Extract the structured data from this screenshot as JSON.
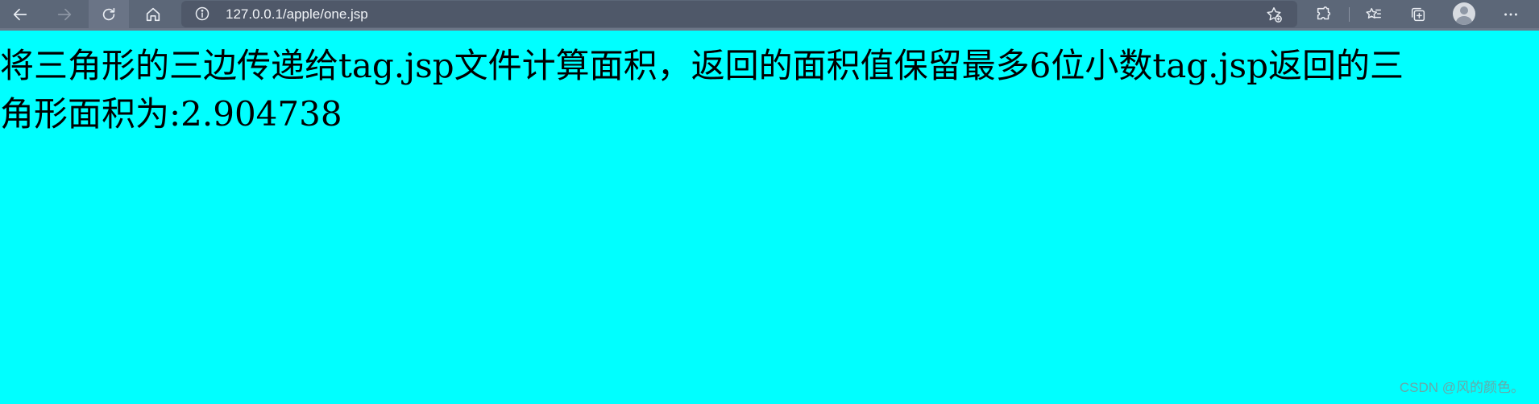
{
  "browser": {
    "url": "127.0.0.1/apple/one.jsp",
    "icons": {
      "back": "back-arrow-icon",
      "forward": "forward-arrow-icon",
      "refresh": "refresh-icon",
      "home": "home-icon",
      "info": "info-icon",
      "favorite_add": "add-favorite-icon",
      "extensions": "extensions-icon",
      "favorites": "favorites-icon",
      "collections": "collections-icon",
      "profile": "profile-icon",
      "more": "more-icon"
    }
  },
  "page": {
    "background": "#00ffff",
    "line1": "将三角形的三边传递给tag.jsp文件计算面积，返回的面积值保留最多6位小数tag.jsp返回的三",
    "line2": "角形面积为:2.904738"
  },
  "watermark": "CSDN @风的颜色。"
}
